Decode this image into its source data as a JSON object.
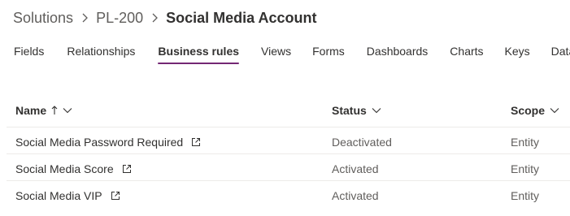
{
  "breadcrumb": {
    "items": [
      "Solutions",
      "PL-200"
    ],
    "current": "Social Media Account",
    "separator_icon": "chevron-right-icon"
  },
  "tabs": [
    {
      "label": "Fields",
      "active": false
    },
    {
      "label": "Relationships",
      "active": false
    },
    {
      "label": "Business rules",
      "active": true
    },
    {
      "label": "Views",
      "active": false
    },
    {
      "label": "Forms",
      "active": false
    },
    {
      "label": "Dashboards",
      "active": false
    },
    {
      "label": "Charts",
      "active": false
    },
    {
      "label": "Keys",
      "active": false
    },
    {
      "label": "Data",
      "active": false
    }
  ],
  "grid": {
    "columns": {
      "name": "Name",
      "status": "Status",
      "scope": "Scope"
    },
    "sort": {
      "column": "name",
      "direction": "ascending"
    },
    "rows": [
      {
        "name": "Social Media Password Required",
        "status": "Deactivated",
        "scope": "Entity"
      },
      {
        "name": "Social Media Score",
        "status": "Activated",
        "scope": "Entity"
      },
      {
        "name": "Social Media VIP",
        "status": "Activated",
        "scope": "Entity"
      }
    ]
  },
  "colors": {
    "accent": "#742774",
    "text": "#323130",
    "secondary_text": "#605e5c",
    "divider": "#edebe9"
  }
}
